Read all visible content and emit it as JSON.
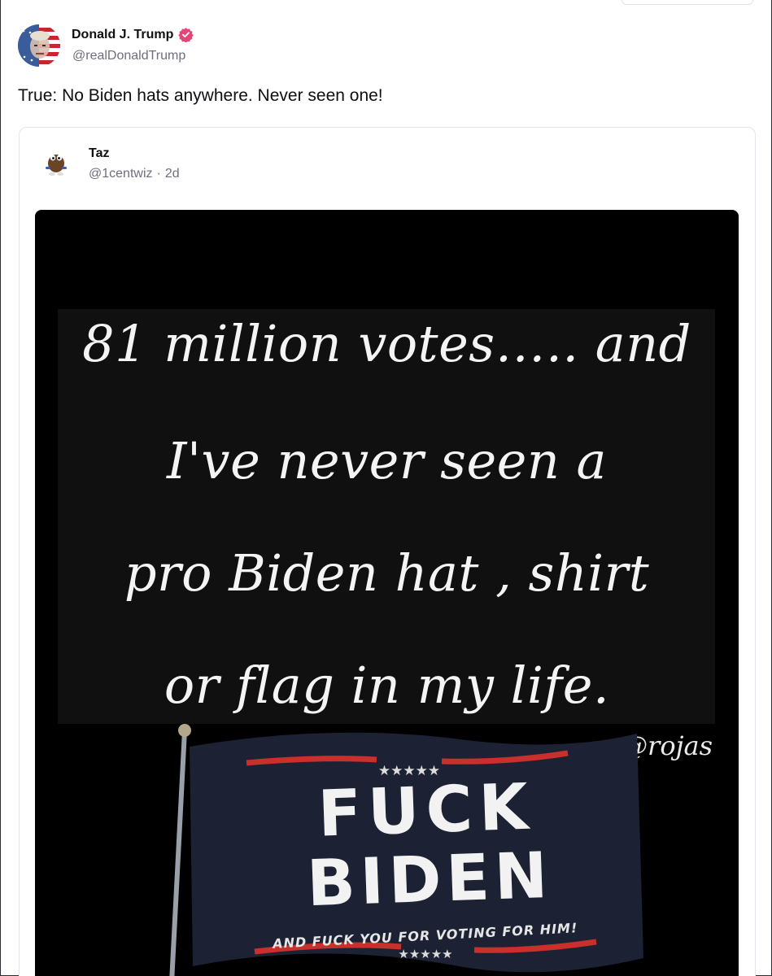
{
  "post": {
    "author_name": "Donald J. Trump",
    "author_handle": "@realDonaldTrump",
    "text": "True: No Biden hats anywhere. Never seen one!",
    "verified": true,
    "verified_color": "#e8447a"
  },
  "quoted_post": {
    "author_name": "Taz",
    "author_handle": "@1centwiz",
    "separator": "·",
    "age": "2d",
    "image": {
      "lines": [
        "81 million votes….. and",
        "I've never seen a",
        "pro Biden hat , shirt",
        "or flag in my life."
      ],
      "watermark": "@rojas",
      "flag_line1": "FUCK",
      "flag_line2": "BIDEN",
      "flag_tagline": "AND FUCK YOU FOR VOTING FOR HIM!",
      "flag_stars": "★★★★★"
    }
  },
  "colors": {
    "text_primary": "#0f0f14",
    "text_secondary": "#6e6e80",
    "card_border": "#e4e4ea",
    "flag_navy": "#1c2233",
    "flag_red": "#c9302c"
  }
}
